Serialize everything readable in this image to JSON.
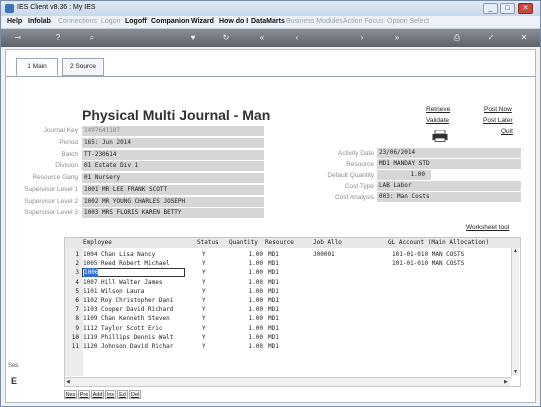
{
  "window": {
    "title": "IES Client v8.36 : My IES",
    "buttons": [
      "_",
      "□",
      "✕"
    ]
  },
  "menu": {
    "items": [
      {
        "label": "Help",
        "enabled": true
      },
      {
        "label": "Infolab",
        "enabled": true
      },
      {
        "label": "Connections",
        "enabled": false
      },
      {
        "label": "Logon",
        "enabled": false
      },
      {
        "label": "Logoff",
        "enabled": true
      },
      {
        "label": "Companion",
        "enabled": true
      },
      {
        "label": "Wizard",
        "enabled": true
      },
      {
        "label": "How do I",
        "enabled": true
      },
      {
        "label": "DataMarts",
        "enabled": true
      },
      {
        "label": "Business Modules",
        "enabled": false
      },
      {
        "label": "Action Focus",
        "enabled": false
      },
      {
        "label": "Option Select",
        "enabled": false
      }
    ]
  },
  "tabs": [
    {
      "label": "1 Main"
    },
    {
      "label": "2 Source"
    }
  ],
  "page_title": "Physical Multi Journal - Man",
  "actions": {
    "retrieve": "Retrieve",
    "validate": "Validate",
    "post_now": "Post Now",
    "post_later": "Post Later",
    "quit": "Quit",
    "worksheet": "Worksheet tool"
  },
  "form_left": [
    {
      "label": "Journal Key",
      "value": "1497641107",
      "muted": true
    },
    {
      "label": "Period",
      "value": "165: Jun 2014"
    },
    {
      "label": "Batch",
      "value": "TT-230614"
    },
    {
      "label": "Division",
      "value": "01 Estate Div 1"
    },
    {
      "label": "Resource Gang",
      "value": "01 Nursery"
    },
    {
      "label": "Supervisor Level 1",
      "value": "1001 MR LEE FRANK SCOTT"
    },
    {
      "label": "Supervisor Level 2",
      "value": "1002 MR YOUNG CHARLES JOSEPH"
    },
    {
      "label": "Supervisor Level 3",
      "value": "1003 MRS FLORIS KAREN BETTY"
    }
  ],
  "form_right": [
    {
      "label": "Activity Date",
      "value": "23/06/2014"
    },
    {
      "label": "Resource",
      "value": "MD1 MANDAY STD"
    },
    {
      "label": "Default Quantity",
      "value": "1.00"
    },
    {
      "label": "Cost Type",
      "value": "LAB Labor"
    },
    {
      "label": "Cost Analysis",
      "value": "003: Man Costs"
    }
  ],
  "grid": {
    "headers": [
      "Employee",
      "Status",
      "Quantity",
      "Resource",
      "Job Allo",
      "GL Account (Main Allocation)"
    ],
    "rows": [
      {
        "n": "1",
        "emp": "1004 Chan Lisa Nancy",
        "status": "Y",
        "qty": "1.00",
        "res": "MD1",
        "job": "J00001",
        "gl": "101-01-010 MAN COSTS"
      },
      {
        "n": "2",
        "emp": "1005 Reed Robert Michael",
        "status": "Y",
        "qty": "1.00",
        "res": "MD1",
        "job": "",
        "gl": "101-01-010 MAN COSTS"
      },
      {
        "n": "3",
        "emp": "1006",
        "status": "Y",
        "qty": "1.00",
        "res": "MD1",
        "job": "",
        "gl": ""
      },
      {
        "n": "4",
        "emp": "1007 Hill Walter James",
        "status": "Y",
        "qty": "1.00",
        "res": "MD1",
        "job": "",
        "gl": ""
      },
      {
        "n": "5",
        "emp": "1101 Wilson Laura",
        "status": "Y",
        "qty": "1.00",
        "res": "MD1",
        "job": "",
        "gl": ""
      },
      {
        "n": "6",
        "emp": "1102 Roy Christopher Dani",
        "status": "Y",
        "qty": "1.00",
        "res": "MD1",
        "job": "",
        "gl": ""
      },
      {
        "n": "7",
        "emp": "1103 Cooper David Richard",
        "status": "Y",
        "qty": "1.00",
        "res": "MD1",
        "job": "",
        "gl": ""
      },
      {
        "n": "8",
        "emp": "1109 Chan Kenneth Steven",
        "status": "Y",
        "qty": "1.00",
        "res": "MD1",
        "job": "",
        "gl": ""
      },
      {
        "n": "9",
        "emp": "1112 Taylor Scott Eric",
        "status": "Y",
        "qty": "1.00",
        "res": "MD1",
        "job": "",
        "gl": ""
      },
      {
        "n": "10",
        "emp": "1119 Phillips Dennis Walt",
        "status": "Y",
        "qty": "1.00",
        "res": "MD1",
        "job": "",
        "gl": ""
      },
      {
        "n": "11",
        "emp": "1120 Johnson David Richar",
        "status": "Y",
        "qty": "1.00",
        "res": "MD1",
        "job": "",
        "gl": ""
      }
    ],
    "buttons": [
      "Nex",
      "Pre",
      "Add",
      "Ins",
      "Ed",
      "Del"
    ]
  },
  "side_strip": {
    "label": "Ses"
  },
  "colors": {
    "field_bg": "#d6d6d6",
    "toolbar_bg": "#6b7078",
    "menu_disabled": "#9aa3b0"
  }
}
